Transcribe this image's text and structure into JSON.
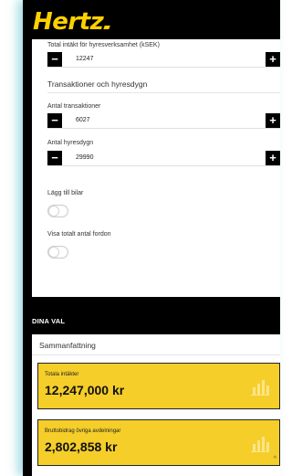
{
  "brand": {
    "logo_text": "Hertz",
    "accent_color": "#FFD100"
  },
  "form": {
    "total_income": {
      "label": "Total intäkt för hyresverksamhet (kSEK)",
      "value": "12247"
    },
    "section_title": "Transaktioner och hyresdygn",
    "transactions": {
      "label": "Antal transaktioner",
      "value": "6027"
    },
    "rental_days": {
      "label": "Antal hyresdygn",
      "value": "29990"
    },
    "add_cars": {
      "label": "Lägg till bilar",
      "checked": false
    },
    "show_total_vehicles": {
      "label": "Visa totalt antal fordon",
      "checked": false
    },
    "minus_glyph": "−",
    "plus_glyph": "+"
  },
  "summary": {
    "header": "DINA VAL",
    "title": "Sammanfattning",
    "cards": [
      {
        "label": "Totala intäkter",
        "value": "12,247,000 kr",
        "color": "#F5CE2A"
      },
      {
        "label": "Bruttobidrag övriga avdelningar",
        "value": "2,802,858 kr",
        "color": "#F5CE2A"
      }
    ],
    "scroll_glyph": "^"
  }
}
